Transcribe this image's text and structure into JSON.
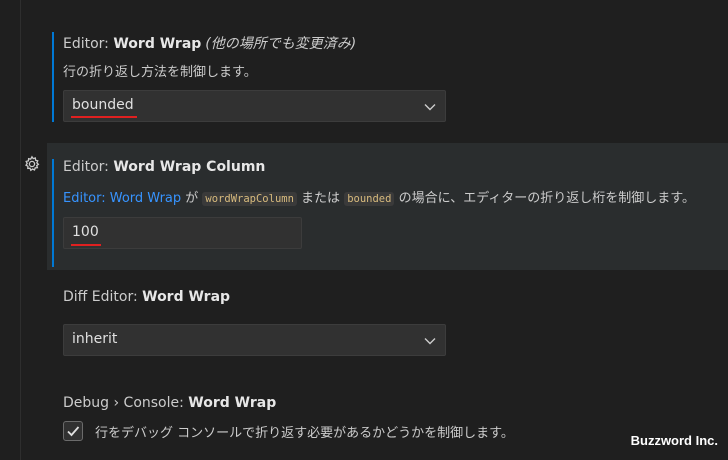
{
  "word_wrap": {
    "category": "Editor: ",
    "name": "Word Wrap",
    "modified_note": "(他の場所でも変更済み)",
    "description": "行の折り返し方法を制御します。",
    "value": "bounded"
  },
  "word_wrap_column": {
    "category": "Editor: ",
    "name": "Word Wrap Column",
    "desc_link": "Editor: Word Wrap",
    "desc_ga": " が ",
    "code1": "wordWrapColumn",
    "desc_mataha": " または ",
    "code2": "bounded",
    "desc_rest": " の場合に、エディターの折り返し桁を制御します。",
    "value": "100"
  },
  "diff_word_wrap": {
    "category": "Diff Editor: ",
    "name": "Word Wrap",
    "value": "inherit"
  },
  "debug_word_wrap": {
    "category": "Debug › Console: ",
    "name": "Word Wrap",
    "checked": true,
    "label": "行をデバッグ コンソールで折り返す必要があるかどうかを制御します。"
  },
  "watermark": "Buzzword Inc.",
  "colors": {
    "accent": "#0078d4",
    "link": "#3794ff",
    "highlight_underline": "#e02020"
  }
}
